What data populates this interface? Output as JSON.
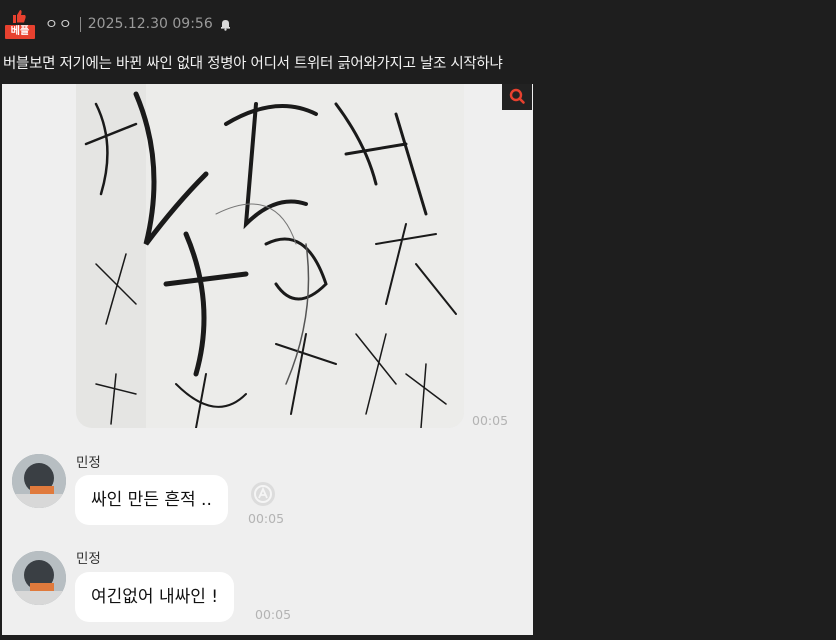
{
  "post": {
    "badge_label": "베플",
    "author": "ㅇㅇ",
    "date": "2025.12.30 09:56",
    "title": "버블보면 저기에는 바뀐 싸인 없대 정병아 어디서 트위터 긁어와가지고 날조 시작하냐"
  },
  "icons": {
    "thumb": "thumbs-up-icon",
    "bell": "notification-icon",
    "zoom": "search-icon",
    "read": "read-receipt-icon"
  },
  "chat": {
    "image_time": "00:05",
    "messages": [
      {
        "sender": "민정",
        "text": "싸인 만든 흔적 ..",
        "time": "00:05"
      },
      {
        "sender": "민정",
        "text": "여긴없어 내싸인 !",
        "time": "00:05"
      }
    ]
  },
  "colors": {
    "badge": "#e8412f",
    "page_bg": "#1e1e1e",
    "chat_bg": "#efefef",
    "zoom_icon": "#e8412f"
  }
}
